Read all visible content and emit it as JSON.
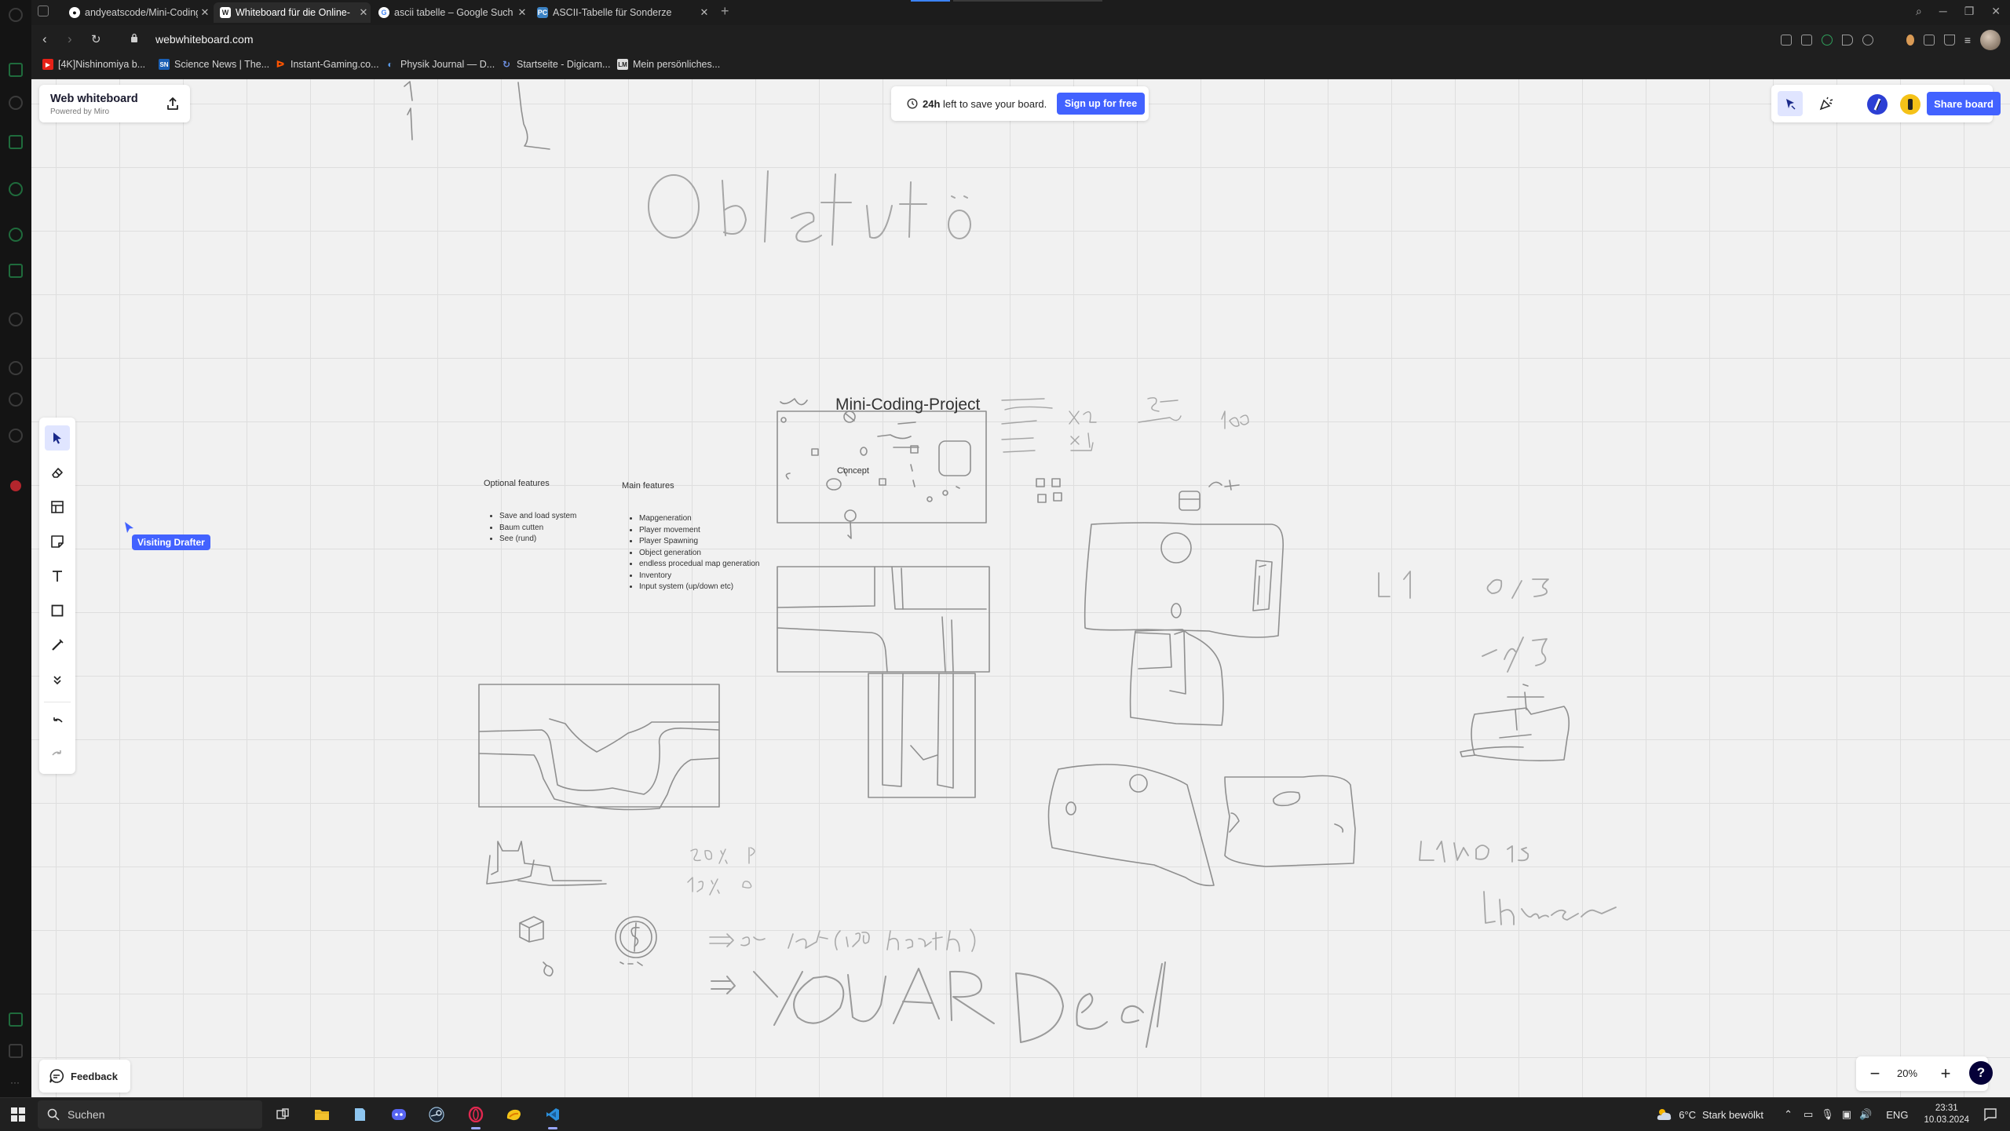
{
  "browser": {
    "tabs": [
      {
        "title": "andyeatscode/Mini-Coding-",
        "icon": "github-icon",
        "active": false
      },
      {
        "title": "Whiteboard für die Online-",
        "icon": "webwhiteboard-icon",
        "active": true
      },
      {
        "title": "ascii tabelle – Google Such",
        "icon": "google-icon",
        "active": false
      },
      {
        "title": "ASCII-Tabelle für Sonderze",
        "icon": "pc-icon",
        "active": false
      }
    ],
    "url": "webwhiteboard.com",
    "bookmarks": [
      {
        "label": "[4K]Nishinomiya b...",
        "icon": "youtube-icon",
        "color": "#e62117"
      },
      {
        "label": "Science News | The...",
        "icon": "sn-icon",
        "color": "#1a5fb4"
      },
      {
        "label": "Instant-Gaming.co...",
        "icon": "instant-gaming-icon",
        "color": "#ff5400"
      },
      {
        "label": "Physik Journal — D...",
        "icon": "physik-icon",
        "color": "#2b6cb0"
      },
      {
        "label": "Startseite - Digicam...",
        "icon": "digicam-icon",
        "color": "#3a6fd8"
      },
      {
        "label": "Mein persönliches...",
        "icon": "lm-icon",
        "color": "#ddd"
      }
    ]
  },
  "whiteboard": {
    "logo_title": "Web whiteboard",
    "logo_subtitle": "Powered by Miro",
    "save_hours": "24h",
    "save_text": " left to save your board.",
    "signup_label": "Sign up for free",
    "share_label": "Share board",
    "visiting_label": "Visiting Drafter",
    "board_title": "Mini-Coding-Project",
    "concept_label": "Concept",
    "optional_heading": "Optional features",
    "optional_items": [
      "Save and load system",
      "Baum cutten",
      "See (rund)"
    ],
    "main_heading": "Main features",
    "main_items": [
      "Mapgeneration",
      "Player movement",
      "Player Spawning",
      "Object generation",
      "endless procedual map generation",
      "Inventory",
      "Input system (up/down etc)"
    ],
    "feedback_label": "Feedback",
    "zoom_level": "20%",
    "help_label": "?",
    "accent_color": "#4262ff"
  },
  "taskbar": {
    "search_placeholder": "Suchen",
    "weather_temp": "6°C",
    "weather_text": "Stark bewölkt",
    "language": "ENG",
    "time": "23:31",
    "date": "10.03.2024"
  }
}
